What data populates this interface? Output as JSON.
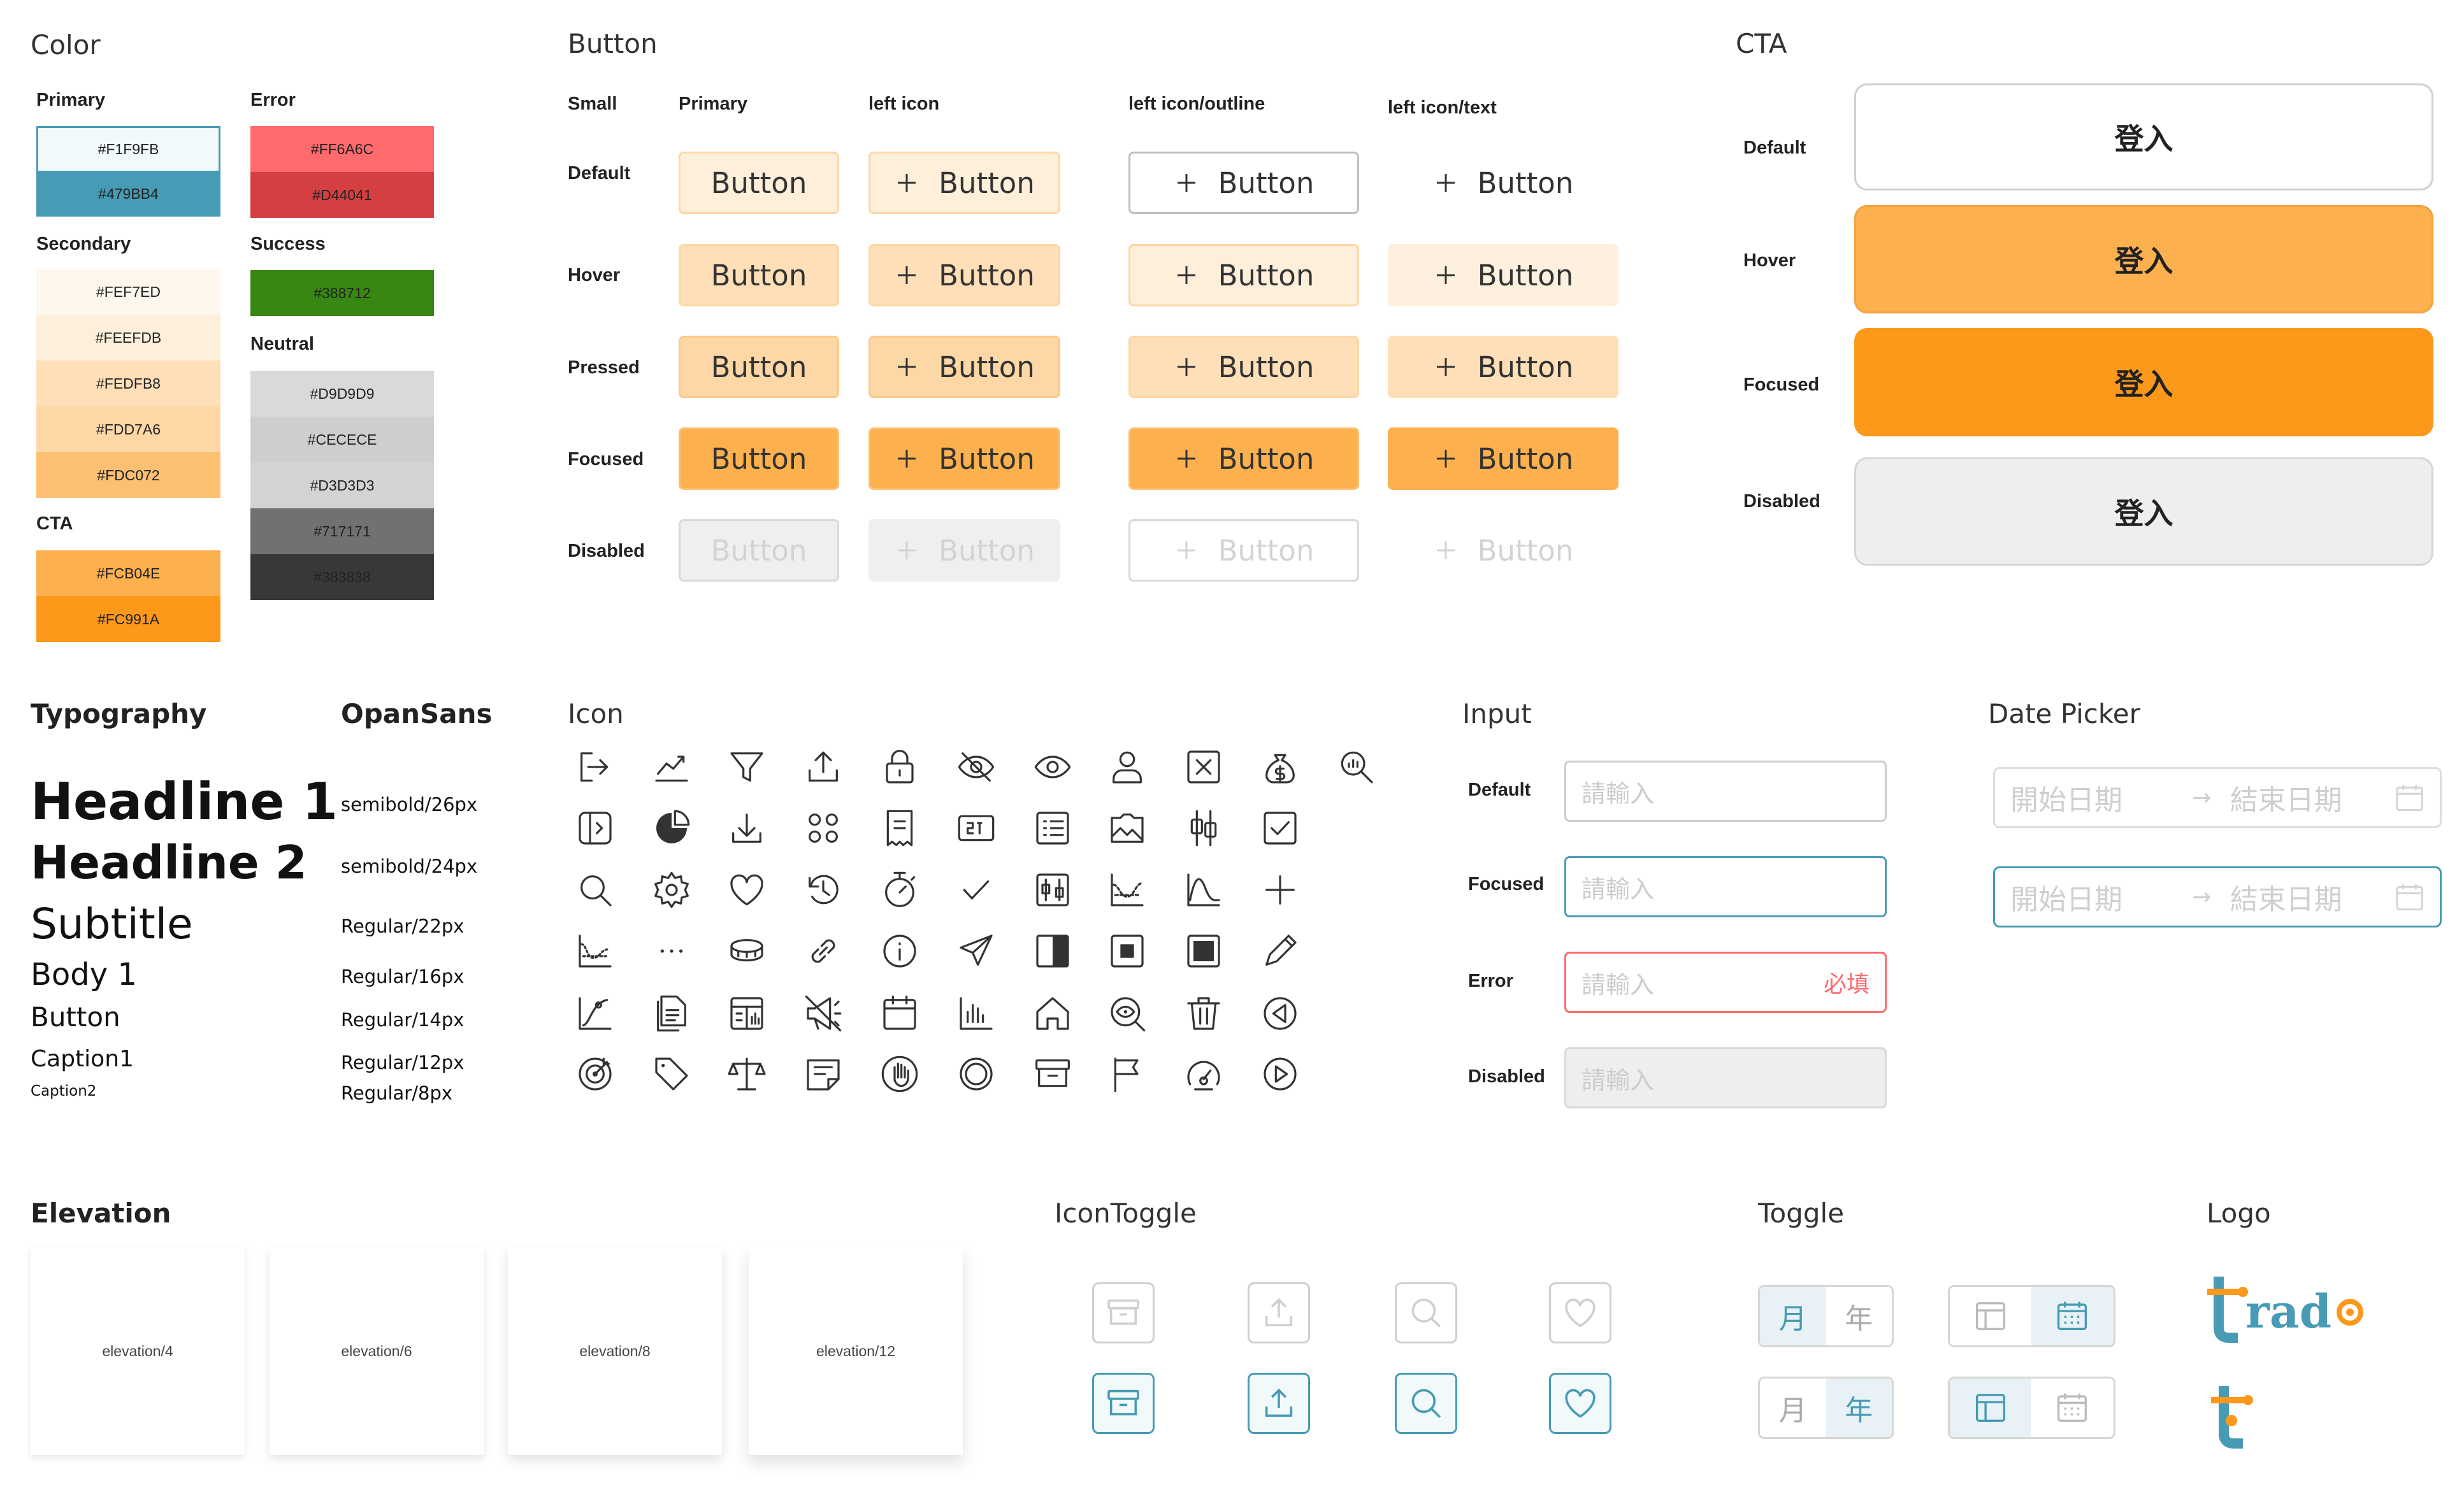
{
  "sections": {
    "color": "Color",
    "button": "Button",
    "cta": "CTA",
    "typography": "Typography",
    "font": "OpanSans",
    "icon": "Icon",
    "input": "Input",
    "datepicker": "Date Picker",
    "elevation": "Elevation",
    "icontoggle": "IconToggle",
    "toggle": "Toggle",
    "logo": "Logo"
  },
  "colors": {
    "primary": {
      "label": "Primary",
      "swatches": [
        "#F1F9FB",
        "#479BB4"
      ]
    },
    "secondary": {
      "label": "Secondary",
      "swatches": [
        "#FEF7ED",
        "#FEEFDB",
        "#FEDFB8",
        "#FDD7A6",
        "#FDC072"
      ]
    },
    "cta": {
      "label": "CTA",
      "swatches": [
        "#FCB04E",
        "#FC991A"
      ]
    },
    "error": {
      "label": "Error",
      "swatches": [
        "#FF6A6C",
        "#D44041"
      ]
    },
    "success": {
      "label": "Success",
      "swatches": [
        "#388712"
      ]
    },
    "neutral": {
      "label": "Neutral",
      "swatches": [
        "#D9D9D9",
        "#CECECE",
        "#D3D3D3",
        "#717171",
        "#383838"
      ]
    }
  },
  "button": {
    "columns": [
      "Small",
      "Primary",
      "left icon",
      "left icon/outline",
      "left icon/text"
    ],
    "states": [
      "Default",
      "Hover",
      "Pressed",
      "Focused",
      "Disabled"
    ],
    "label": "Button"
  },
  "cta": {
    "states": [
      "Default",
      "Hover",
      "Focused",
      "Disabled"
    ],
    "label": "登入"
  },
  "typography": {
    "styles": [
      {
        "name": "Headline 1",
        "spec": "semibold/26px"
      },
      {
        "name": "Headline 2",
        "spec": "semibold/24px"
      },
      {
        "name": "Subtitle",
        "spec": "Regular/22px"
      },
      {
        "name": "Body 1",
        "spec": "Regular/16px"
      },
      {
        "name": "Button",
        "spec": "Regular/14px"
      },
      {
        "name": "Caption1",
        "spec": "Regular/12px"
      },
      {
        "name": "Caption2",
        "spec": "Regular/8px"
      }
    ]
  },
  "icons": [
    [
      "logout-icon",
      "chart-up-icon",
      "filter-icon",
      "upload-icon",
      "lock-icon",
      "eye-off-icon",
      "eye-icon",
      "user-icon",
      "close-box-icon",
      "money-bag-icon",
      "search-chart-icon"
    ],
    [
      "toggle-panel-icon",
      "pie-icon",
      "download-icon",
      "apps-icon",
      "receipt-icon",
      "code-box-icon",
      "list-icon",
      "image-icon",
      "sliders-icon",
      "checkbox-icon"
    ],
    [
      "search-icon",
      "gear-icon",
      "heart-icon",
      "history-icon",
      "stopwatch-icon",
      "check-icon",
      "chart-box-icon",
      "wave-chart-icon",
      "curve-icon",
      "plus-icon"
    ],
    [
      "line-chart-icon",
      "more-icon",
      "coins-icon",
      "link-icon",
      "info-icon",
      "send-icon",
      "half-square-icon",
      "stop-icon",
      "square-icon",
      "pencil-icon"
    ],
    [
      "growth-icon",
      "document-icon",
      "table-icon",
      "megaphone-icon",
      "calendar-icon",
      "bar-chart-icon",
      "home-icon",
      "zoom-eye-icon",
      "trash-icon",
      "back-icon"
    ],
    [
      "target-icon",
      "tag-icon",
      "scale-icon",
      "note-icon",
      "hand-icon",
      "circle-icon",
      "archive-icon",
      "flag-icon",
      "gauge-icon",
      "play-icon"
    ]
  ],
  "input": {
    "states": [
      "Default",
      "Focused",
      "Error",
      "Disabled"
    ],
    "placeholder": "請輸入",
    "required": "必填"
  },
  "datepicker": {
    "start": "開始日期",
    "end": "結束日期",
    "arrow": "→"
  },
  "elevation": [
    "elevation/4",
    "elevation/6",
    "elevation/8",
    "elevation/12"
  ],
  "toggle": {
    "month": "月",
    "year": "年"
  },
  "logo": {
    "text": "trado"
  }
}
